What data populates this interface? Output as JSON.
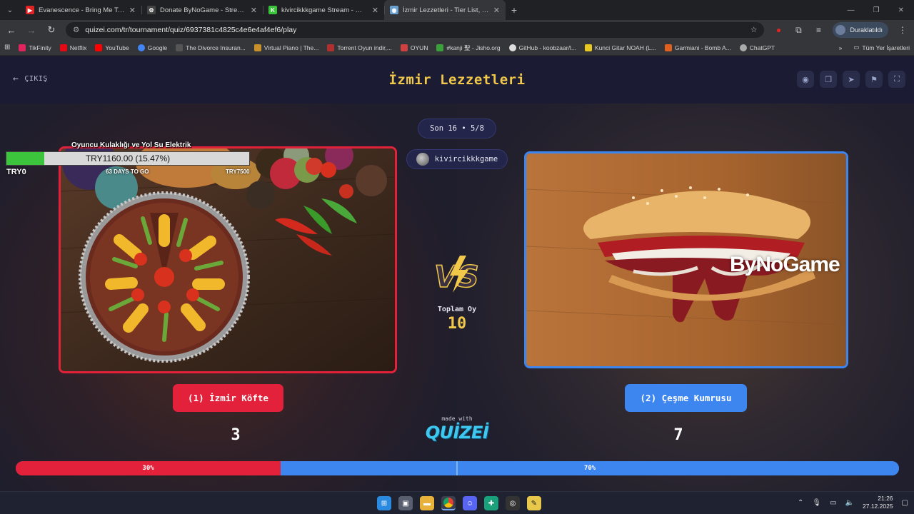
{
  "browser": {
    "tabs": [
      {
        "title": "Evanescence - Bring Me To Life",
        "favicon_color": "#e02424",
        "glyph": "▶",
        "active": false
      },
      {
        "title": "Donate ByNoGame - Streamer",
        "favicon_color": "#444444",
        "glyph": "⚙",
        "active": false
      },
      {
        "title": "kivircikkkgame Stream - Watch",
        "favicon_color": "#3ac43a",
        "glyph": "K",
        "active": false
      },
      {
        "title": "İzmir Lezzetleri - Tier List, Kör S",
        "favicon_color": "#6aa0d0",
        "glyph": "◉",
        "active": true
      }
    ],
    "url": "quizei.com/tr/tournament/quiz/6937381c4825c4e6e4af4ef6/play",
    "profile_status": "Duraklatıldı",
    "bookmarks": [
      {
        "label": "TikFinity",
        "color": "#e0245e"
      },
      {
        "label": "Netflix",
        "color": "#e50914"
      },
      {
        "label": "YouTube",
        "color": "#ff0000"
      },
      {
        "label": "Google",
        "color": "#4285f4"
      },
      {
        "label": "The Divorce Insuran...",
        "color": "#555555"
      },
      {
        "label": "Virtual Piano | The...",
        "color": "#c8902a"
      },
      {
        "label": "Torrent Oyun indir,...",
        "color": "#b03030"
      },
      {
        "label": "OYUN",
        "color": "#d04040"
      },
      {
        "label": "#kanji 聖 - Jisho.org",
        "color": "#3aa03a"
      },
      {
        "label": "GitHub - koobzaar/l...",
        "color": "#dddddd"
      },
      {
        "label": "Kunci Gitar NOAH (L...",
        "color": "#e8c820"
      },
      {
        "label": "Garmiani - Bomb A...",
        "color": "#e06020"
      },
      {
        "label": "ChatGPT",
        "color": "#aaaaaa"
      }
    ],
    "bookmarks_more": "»",
    "all_bookmarks": "Tüm Yer İşaretleri"
  },
  "quiz": {
    "exit_label": "ÇIKIŞ",
    "title": "İzmir Lezzetleri",
    "round": "Son 16 • 5/8",
    "streamer": "kivircikkkgame",
    "vs_label": "VS",
    "total_votes_label": "Toplam Oy",
    "total_votes": "10",
    "made_with": "made with",
    "brand": "QUİZEİ",
    "left": {
      "label": "(1) İzmir Köfte",
      "votes": "3",
      "percent_label": "30%",
      "percent": 30,
      "color": "#e3213a"
    },
    "right": {
      "label": "(2) Çeşme Kumrusu",
      "votes": "7",
      "percent_label": "70%",
      "percent": 70,
      "color": "#3d86f0"
    }
  },
  "donation": {
    "goal_title": "Oyuncu Kulaklığı ve Yol Su Elektrik",
    "amount_text": "TRY1160.00 (15.47%)",
    "progress_fraction": 0.1547,
    "start": "TRY0",
    "days": "63 DAYS TO GO",
    "goal": "TRY7500"
  },
  "watermark": "ByNoGame",
  "taskbar": {
    "time": "21:26",
    "date": "27.12.2025"
  }
}
